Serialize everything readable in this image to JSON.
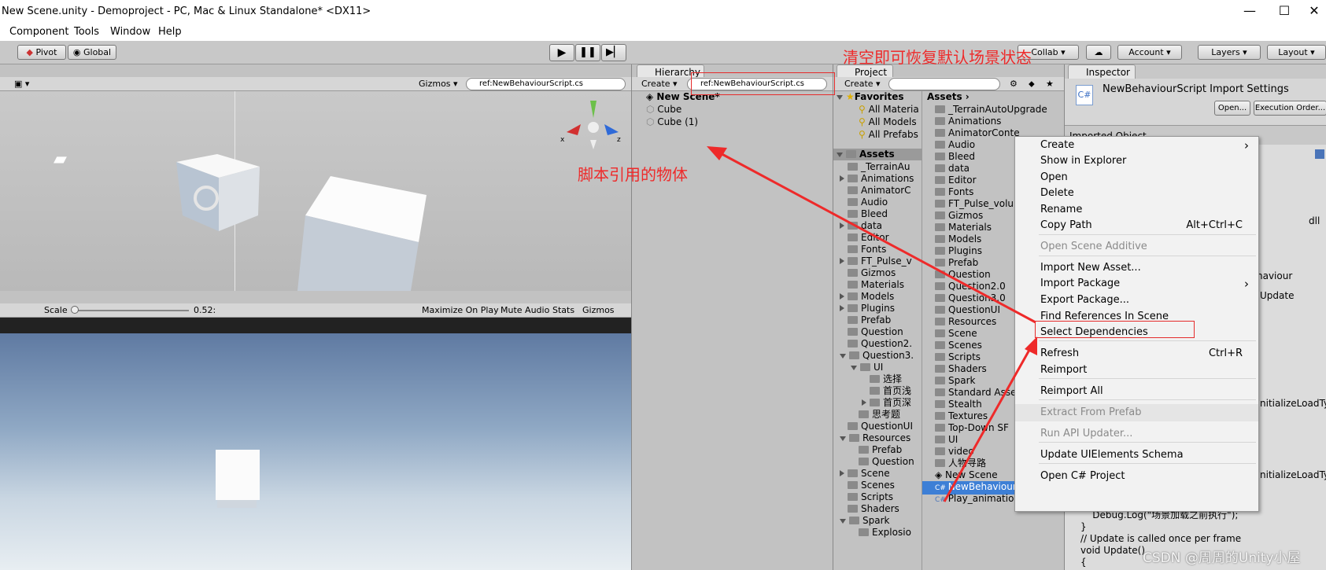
{
  "window": {
    "title": "New Scene.unity - Demoproject - PC, Mac & Linux Standalone* <DX11>",
    "minimize": "—",
    "maximize": "☐",
    "close": "✕"
  },
  "menu": [
    "Component",
    "Tools",
    "Window",
    "Help"
  ],
  "toolbar": {
    "pivot": "Pivot",
    "global": "Global",
    "collab": "Collab",
    "account": "Account",
    "layers": "Layers",
    "layout": "Layout"
  },
  "scene": {
    "gizmos": "Gizmos",
    "search": "ref:NewBehaviourScript.cs",
    "gizmo_x": "x",
    "gizmo_z": "z"
  },
  "game": {
    "scale_label": "Scale",
    "scale_value": "0.52:",
    "scale_fraction": 0.02,
    "maximize": "Maximize On Play",
    "mute": "Mute Audio",
    "stats": "Stats",
    "gizmos": "Gizmos"
  },
  "hierarchy": {
    "tab": "Hierarchy",
    "create": "Create",
    "search": "ref:NewBehaviourScript.cs",
    "scene_name": "New Scene*",
    "items": [
      "Cube",
      "Cube (1)"
    ]
  },
  "project": {
    "tab": "Project",
    "create": "Create",
    "favorites_label": "Favorites",
    "favorites": [
      "All Materia",
      "All Models",
      "All Prefabs"
    ],
    "assets_root": "Assets",
    "tree": [
      {
        "label": "_TerrainAu",
        "depth": 1,
        "arrow": ""
      },
      {
        "label": "Animations",
        "depth": 1,
        "arrow": "r"
      },
      {
        "label": "AnimatorC",
        "depth": 1,
        "arrow": ""
      },
      {
        "label": "Audio",
        "depth": 1,
        "arrow": ""
      },
      {
        "label": "Bleed",
        "depth": 1,
        "arrow": ""
      },
      {
        "label": "data",
        "depth": 1,
        "arrow": "r"
      },
      {
        "label": "Editor",
        "depth": 1,
        "arrow": ""
      },
      {
        "label": "Fonts",
        "depth": 1,
        "arrow": ""
      },
      {
        "label": "FT_Pulse_v",
        "depth": 1,
        "arrow": "r"
      },
      {
        "label": "Gizmos",
        "depth": 1,
        "arrow": ""
      },
      {
        "label": "Materials",
        "depth": 1,
        "arrow": ""
      },
      {
        "label": "Models",
        "depth": 1,
        "arrow": "r"
      },
      {
        "label": "Plugins",
        "depth": 1,
        "arrow": "r"
      },
      {
        "label": "Prefab",
        "depth": 1,
        "arrow": ""
      },
      {
        "label": "Question",
        "depth": 1,
        "arrow": ""
      },
      {
        "label": "Question2.",
        "depth": 1,
        "arrow": ""
      },
      {
        "label": "Question3.",
        "depth": 1,
        "arrow": "d"
      },
      {
        "label": "UI",
        "depth": 2,
        "arrow": "d"
      },
      {
        "label": "选择",
        "depth": 3,
        "arrow": ""
      },
      {
        "label": "首页浅",
        "depth": 3,
        "arrow": ""
      },
      {
        "label": "首页深",
        "depth": 3,
        "arrow": "r"
      },
      {
        "label": "思考题",
        "depth": 2,
        "arrow": ""
      },
      {
        "label": "QuestionUI",
        "depth": 1,
        "arrow": ""
      },
      {
        "label": "Resources",
        "depth": 1,
        "arrow": "d"
      },
      {
        "label": "Prefab",
        "depth": 2,
        "arrow": ""
      },
      {
        "label": "Question",
        "depth": 2,
        "arrow": ""
      },
      {
        "label": "Scene",
        "depth": 1,
        "arrow": "r"
      },
      {
        "label": "Scenes",
        "depth": 1,
        "arrow": ""
      },
      {
        "label": "Scripts",
        "depth": 1,
        "arrow": ""
      },
      {
        "label": "Shaders",
        "depth": 1,
        "arrow": ""
      },
      {
        "label": "Spark",
        "depth": 1,
        "arrow": "d"
      },
      {
        "label": "Explosio",
        "depth": 2,
        "arrow": ""
      }
    ],
    "assets_header": "Assets",
    "assets": [
      "_TerrainAutoUpgrade",
      "Animations",
      "AnimatorConte",
      "Audio",
      "Bleed",
      "data",
      "Editor",
      "Fonts",
      "FT_Pulse_volu",
      "Gizmos",
      "Materials",
      "Models",
      "Plugins",
      "Prefab",
      "Question",
      "Question2.0",
      "Question3.0",
      "QuestionUI",
      "Resources",
      "Scene",
      "Scenes",
      "Scripts",
      "Shaders",
      "Spark",
      "Standard Asse",
      "Stealth",
      "Textures",
      "Top-Down SF",
      "UI",
      "video",
      "人物寻路"
    ],
    "scene_file": "New Scene",
    "selected_script": "NewBehaviourScript",
    "other_script": "Play_animations"
  },
  "inspector": {
    "tab": "Inspector",
    "title": "NewBehaviourScript Import Settings",
    "open": "Open...",
    "exec": "Execution Order...",
    "imported": "Imported Object",
    "cs_label": "C#",
    "fragments": [
      "dll",
      "haviour",
      "Update",
      "nitializeLoadTyp",
      "nitializeLoadTyp"
    ],
    "code": [
      "    Debug.Log(\"场景加载之前执行\");",
      "}",
      "// Update is called once per frame",
      "void Update()",
      "{"
    ]
  },
  "context_menu": [
    {
      "label": "Create",
      "shortcut": "",
      "arrow": "›",
      "disabled": false
    },
    {
      "label": "Show in Explorer",
      "shortcut": "",
      "arrow": "",
      "disabled": false
    },
    {
      "label": "Open",
      "shortcut": "",
      "arrow": "",
      "disabled": false
    },
    {
      "label": "Delete",
      "shortcut": "",
      "arrow": "",
      "disabled": false
    },
    {
      "label": "Rename",
      "shortcut": "",
      "arrow": "",
      "disabled": false
    },
    {
      "label": "Copy Path",
      "shortcut": "Alt+Ctrl+C",
      "arrow": "",
      "disabled": false
    },
    {
      "label": "Open Scene Additive",
      "shortcut": "",
      "arrow": "",
      "disabled": true
    },
    {
      "label": "Import New Asset...",
      "shortcut": "",
      "arrow": "",
      "disabled": false
    },
    {
      "label": "Import Package",
      "shortcut": "",
      "arrow": "›",
      "disabled": false
    },
    {
      "label": "Export Package...",
      "shortcut": "",
      "arrow": "",
      "disabled": false
    },
    {
      "label": "Find References In Scene",
      "shortcut": "",
      "arrow": "",
      "disabled": false
    },
    {
      "label": "Select Dependencies",
      "shortcut": "",
      "arrow": "",
      "disabled": false
    },
    {
      "label": "Refresh",
      "shortcut": "Ctrl+R",
      "arrow": "",
      "disabled": false
    },
    {
      "label": "Reimport",
      "shortcut": "",
      "arrow": "",
      "disabled": false
    },
    {
      "label": "Reimport All",
      "shortcut": "",
      "arrow": "",
      "disabled": false
    },
    {
      "label": "Extract From Prefab",
      "shortcut": "",
      "arrow": "",
      "disabled": true
    },
    {
      "label": "Run API Updater...",
      "shortcut": "",
      "arrow": "",
      "disabled": true
    },
    {
      "label": "Update UIElements Schema",
      "shortcut": "",
      "arrow": "",
      "disabled": false
    },
    {
      "label": "Open C# Project",
      "shortcut": "",
      "arrow": "",
      "disabled": false
    }
  ],
  "annotations": {
    "clear_hint": "清空即可恢复默认场景状态",
    "ref_objects": "脚本引用的物体",
    "color": "#ee2a2a"
  },
  "watermark": "CSDN @周周的Unity小屋"
}
